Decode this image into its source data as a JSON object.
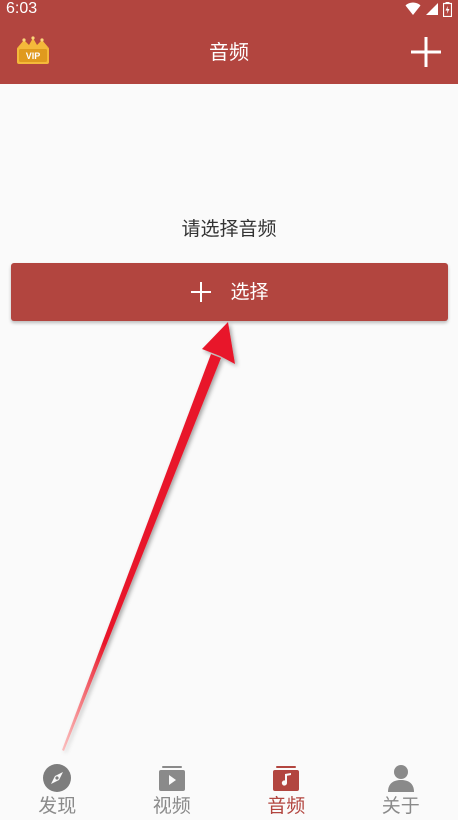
{
  "status_bar": {
    "time": "6:03"
  },
  "header": {
    "title": "音频",
    "vip_badge_text": "VIP",
    "left_icon": "vip-crown-icon",
    "right_icon": "plus-icon"
  },
  "main": {
    "prompt": "请选择音频",
    "select_button_label": "选择"
  },
  "bottom_nav": {
    "items": [
      {
        "label": "发现",
        "icon": "compass-icon",
        "active": false
      },
      {
        "label": "视频",
        "icon": "video-icon",
        "active": false
      },
      {
        "label": "音频",
        "icon": "music-icon",
        "active": true
      },
      {
        "label": "关于",
        "icon": "person-icon",
        "active": false
      }
    ]
  },
  "colors": {
    "primary": "#b2453f",
    "background": "#fafafa",
    "inactive": "#8a8a8a",
    "text": "#333333",
    "vip_gold": "#f5b93a"
  }
}
